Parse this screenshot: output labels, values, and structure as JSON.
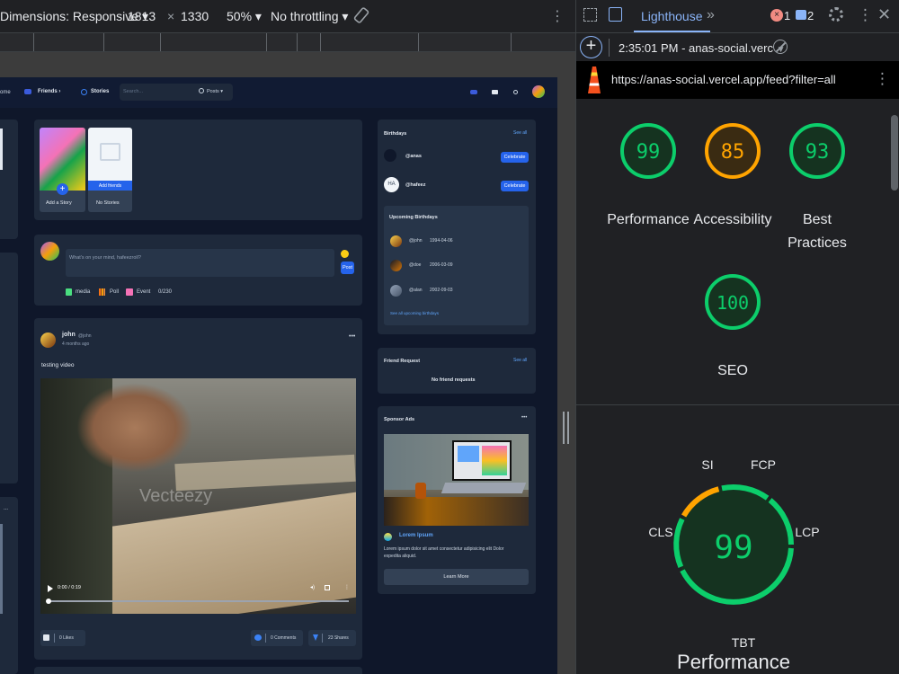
{
  "device_toolbar": {
    "dimensions_label": "Dimensions: Responsive",
    "width": "1813",
    "times": "×",
    "height": "1330",
    "zoom": "50%",
    "throttling": "No throttling"
  },
  "site": {
    "nav": {
      "home": "ome",
      "friends": "Friends",
      "stories": "Stories",
      "search_placeholder": "Search...",
      "search_filter": "Posts"
    },
    "stories": {
      "add_story": "Add a Story",
      "add_friends": "Add friends",
      "no_stories": "No Stories"
    },
    "composer": {
      "placeholder": "What's on your mind, hafeezroll?",
      "post_button": "Post",
      "media": "media",
      "poll": "Poll",
      "event": "Event",
      "counter": "0/230"
    },
    "post": {
      "author": "john",
      "handle": "@john",
      "time": "4 months ago",
      "text": "testing video",
      "video_time": "0:00 / 0:19",
      "watermark": "Vecteezy",
      "likes": "0 Likes",
      "comments": "0 Comments",
      "shares": "23 Shares"
    },
    "birthdays": {
      "title": "Birthdays",
      "see_all": "See all",
      "people": [
        {
          "handle": "@anas",
          "button": "Celebrate"
        },
        {
          "handle": "@hafeez",
          "initials": "HA",
          "button": "Celebrate"
        }
      ],
      "upcoming_title": "Upcoming Birthdays",
      "upcoming": [
        {
          "handle": "@john",
          "date": "1994-04-06"
        },
        {
          "handle": "@doe",
          "date": "2006-03-09"
        },
        {
          "handle": "@alan",
          "date": "2002-09-03"
        }
      ],
      "see_all_upcoming": "See all upcoming birthdays"
    },
    "friend_request": {
      "title": "Friend Request",
      "see_all": "See all",
      "empty": "No friend requests"
    },
    "sponsor": {
      "title": "Sponsor Ads",
      "name": "Lorem Ipsum",
      "text_line1": "Lorem ipsum dolor sit amet consectetur adipisicing elit Dolor",
      "text_line2": "expedita aliquid.",
      "button": "Learn More"
    }
  },
  "devtools": {
    "tab_lighthouse": "Lighthouse",
    "error_count": "1",
    "issue_count": "2",
    "report_time": "2:35:01 PM - anas-social.verc",
    "url": "https://anas-social.vercel.app/feed?filter=all",
    "scores": [
      {
        "name": "Performance",
        "value": 99,
        "color": "#0cce6b"
      },
      {
        "name": "Accessibility",
        "value": 85,
        "color": "#ffa400"
      },
      {
        "name_line1": "Best",
        "name_line2": "Practices",
        "value": 93,
        "color": "#0cce6b"
      },
      {
        "name": "SEO",
        "value": 100,
        "color": "#0cce6b"
      }
    ],
    "gauge": {
      "value": "99",
      "label": "Performance",
      "metrics": {
        "si": "SI",
        "fcp": "FCP",
        "lcp": "LCP",
        "tbt": "TBT",
        "cls": "CLS"
      }
    }
  }
}
